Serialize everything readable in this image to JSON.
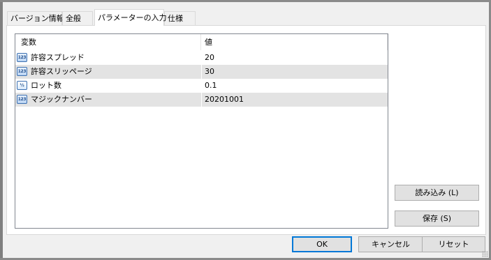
{
  "tabs": [
    {
      "label": "バージョン情報",
      "active": false
    },
    {
      "label": "全般",
      "active": false
    },
    {
      "label": "パラメーターの入力",
      "active": true
    },
    {
      "label": "仕様",
      "active": false
    }
  ],
  "grid": {
    "columns": [
      "変数",
      "値"
    ],
    "rows": [
      {
        "icon": "123",
        "name": "許容スプレッド",
        "value": "20"
      },
      {
        "icon": "123",
        "name": "許容スリッページ",
        "value": "30"
      },
      {
        "icon": "½",
        "name": "ロット数",
        "value": "0.1"
      },
      {
        "icon": "123",
        "name": "マジックナンバー",
        "value": "20201001"
      }
    ]
  },
  "side_buttons": {
    "load": "読み込み (L)",
    "save": "保存 (S)"
  },
  "footer": {
    "ok": "OK",
    "cancel": "キャンセル",
    "reset": "リセット"
  },
  "colors": {
    "accent": "#0078d7",
    "row_alt": "#e3e3e3"
  }
}
